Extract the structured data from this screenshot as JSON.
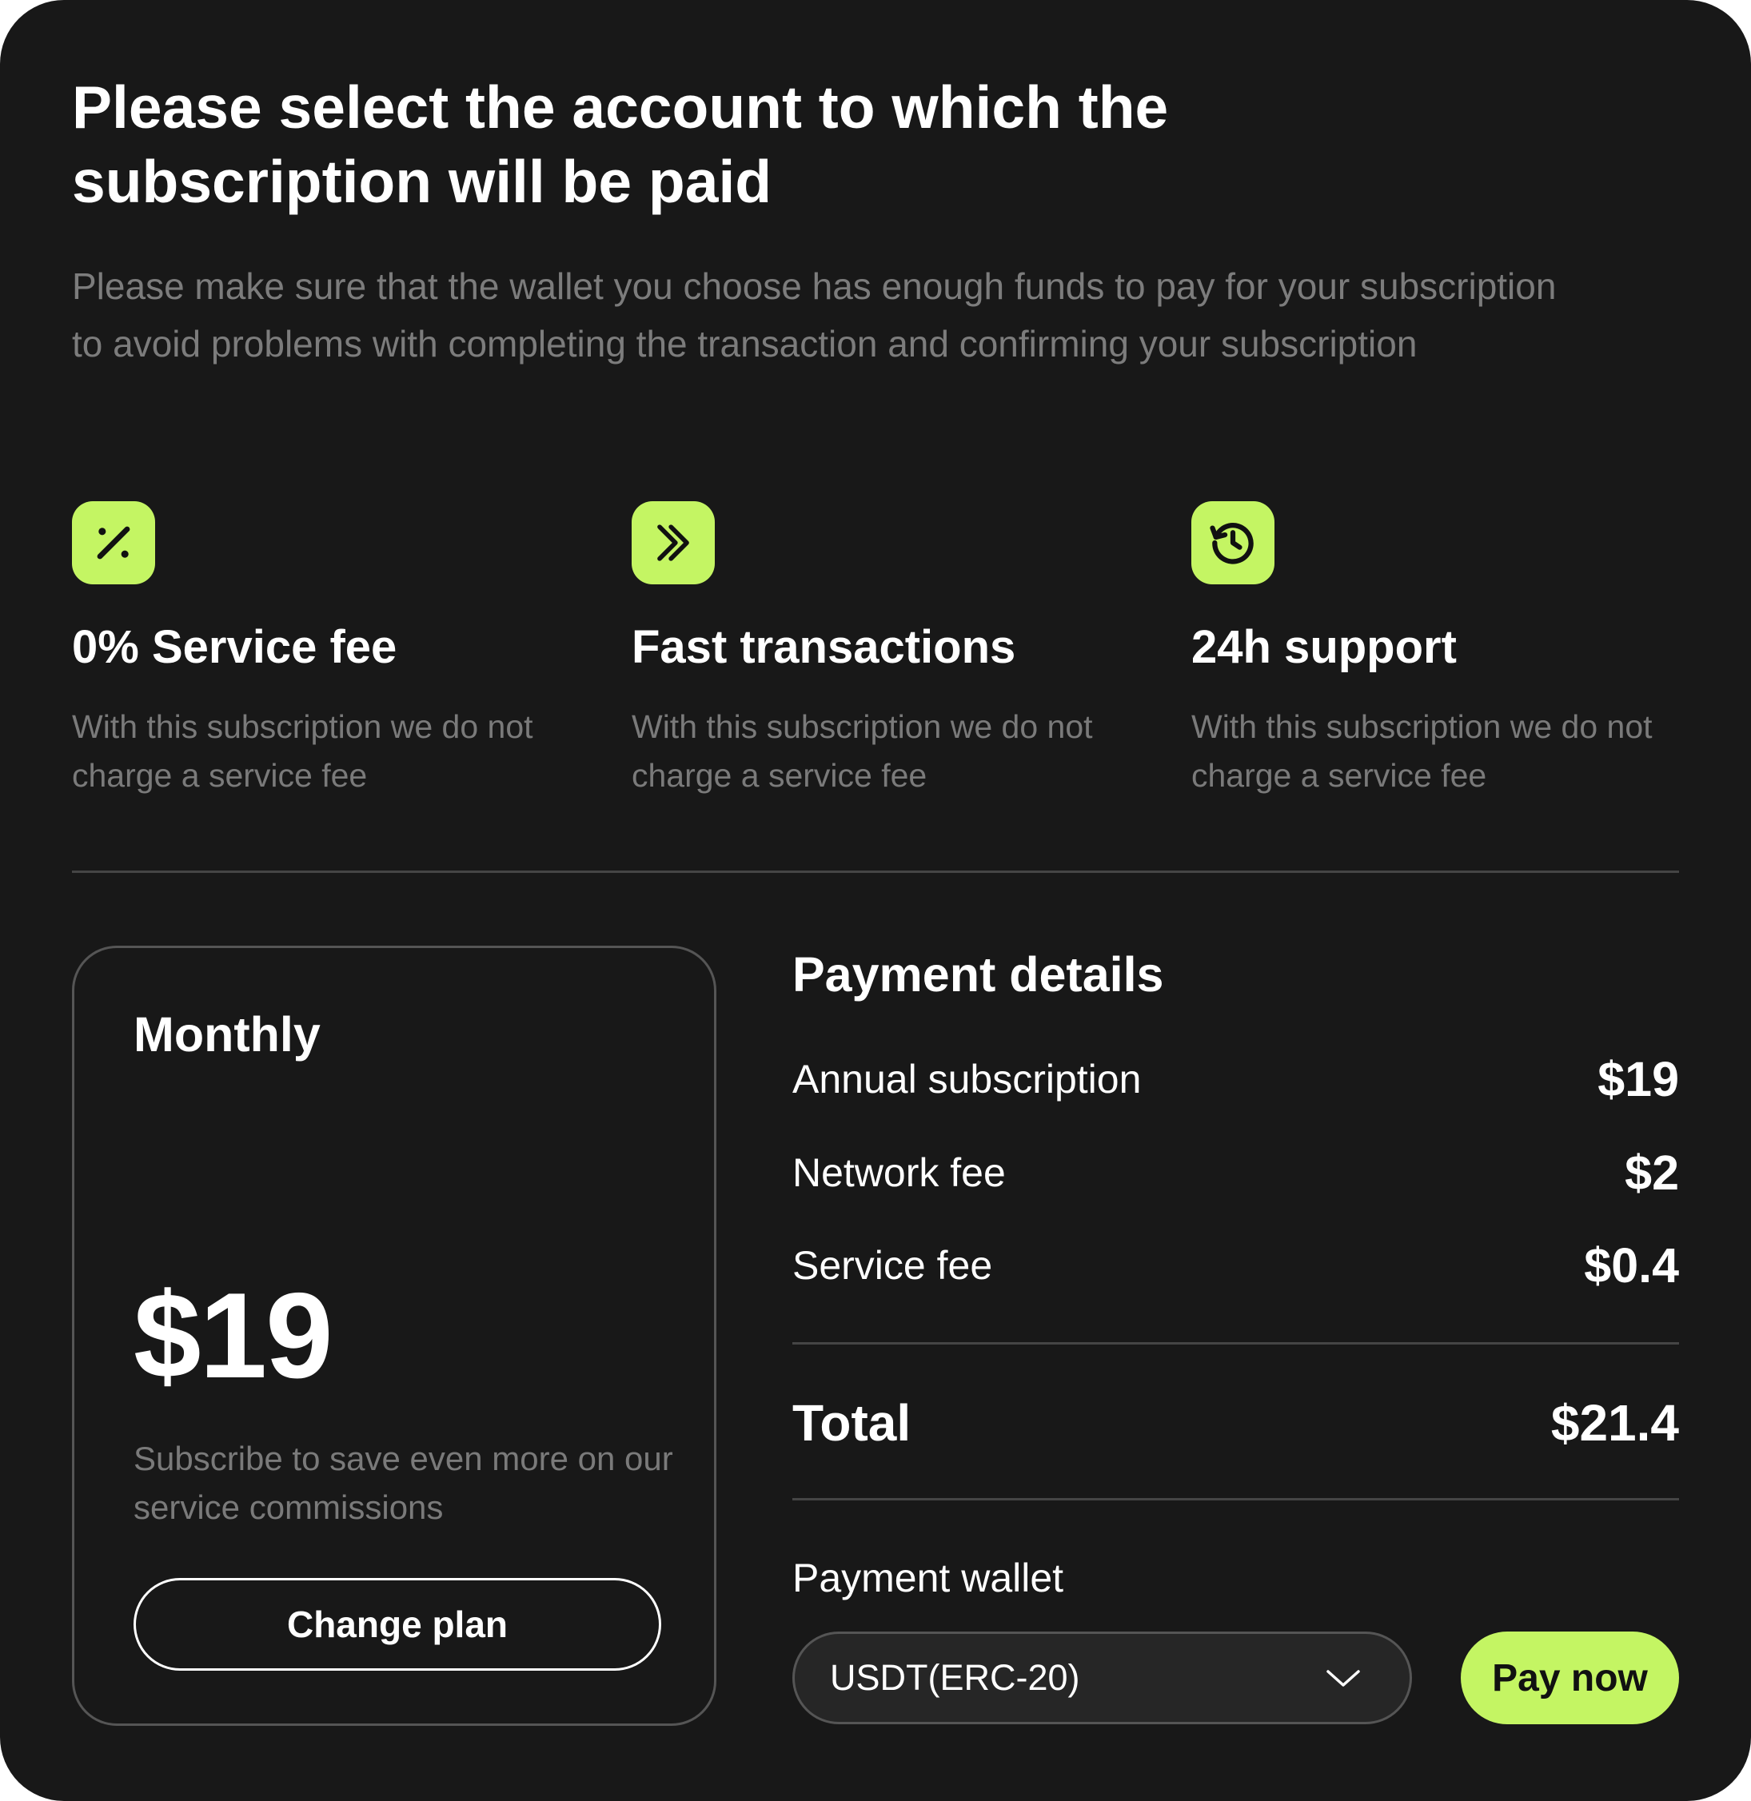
{
  "header": {
    "title": "Please select the account to which the subscription will be paid",
    "subtitle": "Please make sure that the wallet you choose has enough funds to pay for your subscription to avoid problems with completing the transaction and confirming your subscription"
  },
  "features": [
    {
      "icon": "percent-icon",
      "title": "0% Service fee",
      "description": "With this subscription we do not charge a service fee"
    },
    {
      "icon": "chevrons-right-icon",
      "title": "Fast transactions",
      "description": "With this subscription we do not charge a service fee"
    },
    {
      "icon": "history-clock-icon",
      "title": "24h support",
      "description": "With this subscription we do not charge a service fee"
    }
  ],
  "plan": {
    "name": "Monthly",
    "price": "$19",
    "note": "Subscribe to save even more on our service commissions",
    "change_label": "Change plan"
  },
  "payment": {
    "title": "Payment details",
    "rows": [
      {
        "label": "Annual subscription",
        "value": "$19"
      },
      {
        "label": "Network fee",
        "value": "$2"
      },
      {
        "label": "Service fee",
        "value": "$0.4"
      }
    ],
    "total_label": "Total",
    "total_value": "$21.4",
    "wallet_label": "Payment wallet",
    "wallet_value": "USDT(ERC-20)",
    "pay_label": "Pay now"
  },
  "colors": {
    "background": "#181818",
    "accent": "#c4f563",
    "muted_text": "#7a7a7a"
  }
}
